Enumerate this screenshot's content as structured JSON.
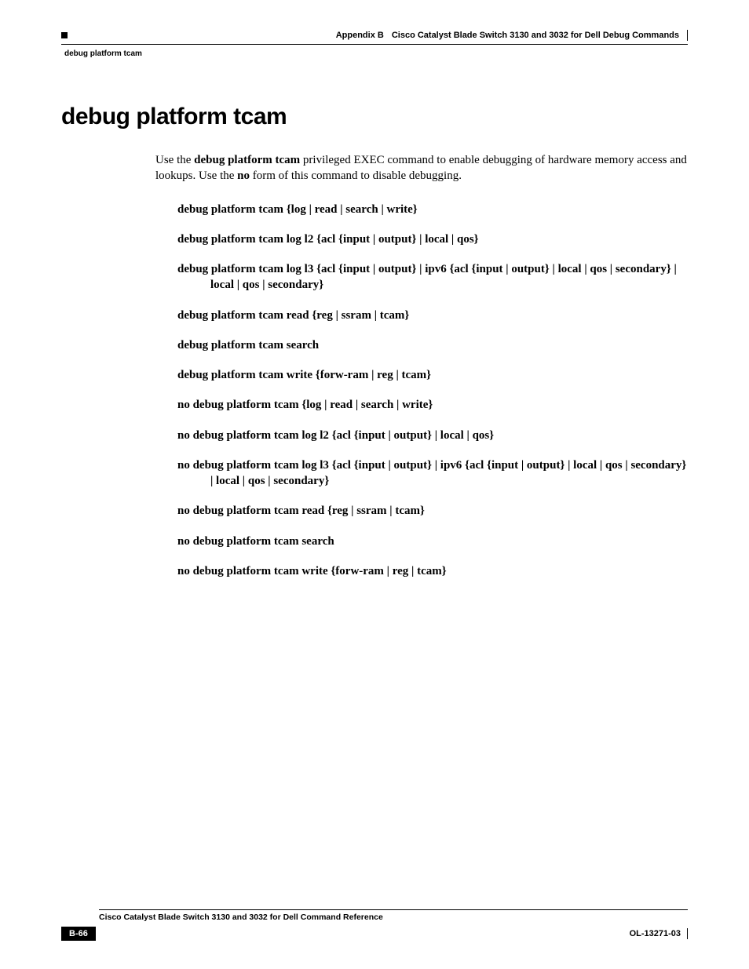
{
  "header": {
    "appendix_label": "Appendix B",
    "appendix_title": "Cisco Catalyst Blade Switch 3130 and 3032 for Dell Debug Commands",
    "section": "debug platform tcam"
  },
  "title": "debug platform tcam",
  "intro": {
    "pre": "Use the ",
    "cmd": "debug platform tcam",
    "mid": " privileged EXEC command to enable debugging of hardware memory access and lookups. Use the ",
    "no": "no",
    "post": " form of this command to disable debugging."
  },
  "syntax": [
    "debug platform tcam {log | read | search | write}",
    "debug platform tcam log l2 {acl {input | output} | local | qos}",
    "debug platform tcam log l3 {acl {input | output} | ipv6 {acl {input | output} | local | qos | secondary} | local | qos | secondary}",
    "debug platform tcam read {reg | ssram | tcam}",
    "debug platform tcam search",
    "debug platform tcam write {forw-ram | reg | tcam}",
    "no debug platform tcam {log | read | search | write}",
    "no debug platform tcam log l2 {acl {input | output} | local | qos}",
    "no debug platform tcam log l3 {acl {input | output} | ipv6 {acl {input | output} | local | qos | secondary} | local | qos | secondary}",
    "no debug platform tcam read {reg | ssram | tcam}",
    "no debug platform tcam search",
    "no debug platform tcam write {forw-ram | reg | tcam}"
  ],
  "footer": {
    "doc_title": "Cisco Catalyst Blade Switch 3130 and 3032 for Dell Command Reference",
    "page_number": "B-66",
    "doc_id": "OL-13271-03"
  }
}
